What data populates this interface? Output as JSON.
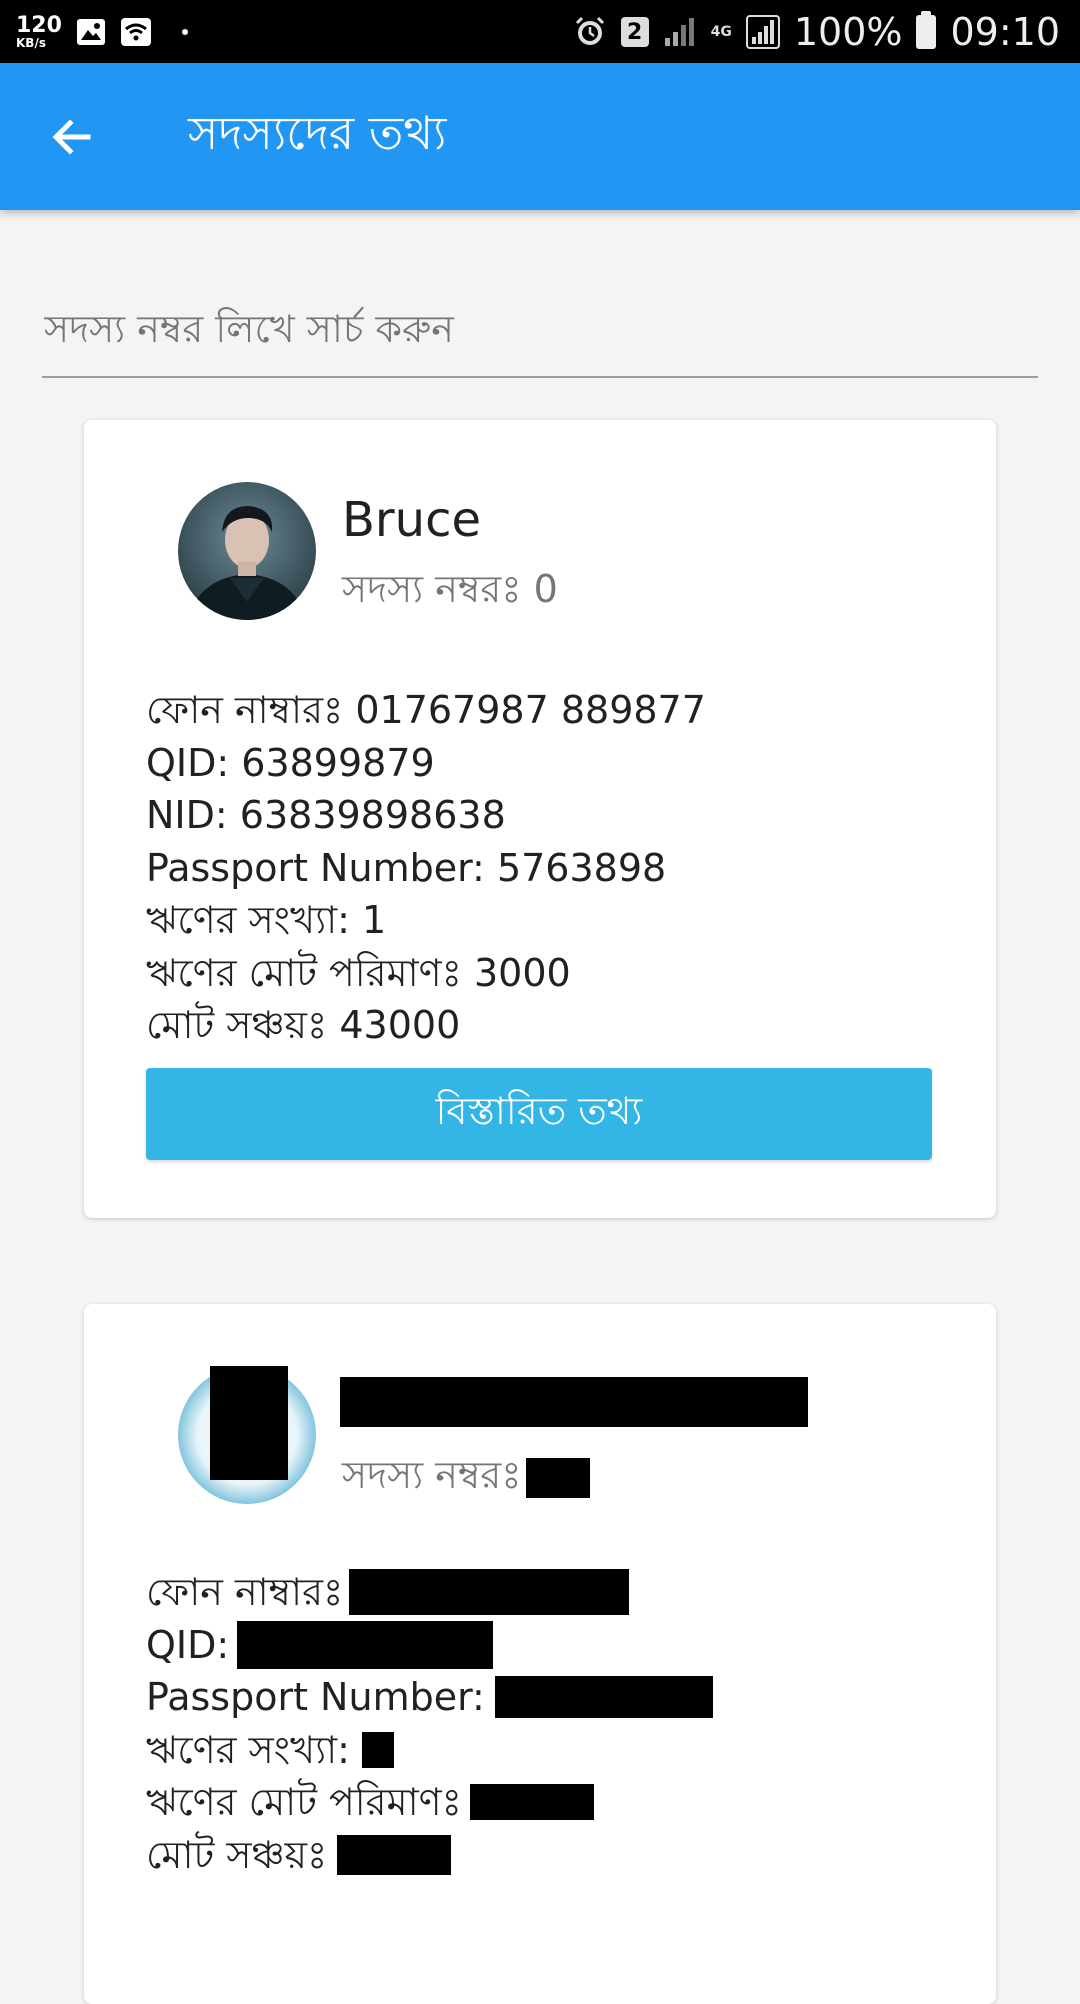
{
  "status_bar": {
    "speed_value": "120",
    "speed_unit": "KB/s",
    "sim_number": "2",
    "network_type": "4G",
    "battery_percent": "100%",
    "time": "09:10"
  },
  "app_bar": {
    "title": "সদস্যদের তথ্য"
  },
  "search": {
    "placeholder": "সদস্য নম্বর লিখে সার্চ করুন"
  },
  "members": [
    {
      "name": "Bruce",
      "member_no_label": "সদস্য নম্বরঃ",
      "member_no": "0",
      "phone_label": "ফোন নাম্বারঃ",
      "phone": "01767987 889877",
      "qid_label": "QID:",
      "qid": "63899879",
      "nid_label": "NID:",
      "nid": "63839898638",
      "passport_label": "Passport Number:",
      "passport": "5763898",
      "loan_count_label": "ঋণের সংখ্যা:",
      "loan_count": "1",
      "loan_total_label": "ঋণের মোট পরিমাণঃ",
      "loan_total": "3000",
      "savings_label": "মোট সঞ্চয়ঃ",
      "savings": "43000",
      "details_button": "বিস্তারিত তথ্য"
    },
    {
      "member_no_label": "সদস্য নম্বরঃ",
      "phone_label": "ফোন নাম্বারঃ",
      "qid_label": "QID:",
      "passport_label": "Passport Number:",
      "loan_count_label": "ঋণের সংখ্যা:",
      "loan_total_label": "ঋণের মোট পরিমাণঃ",
      "savings_label": "মোট সঞ্চয়ঃ"
    }
  ],
  "colors": {
    "app_bar": "#2196f3",
    "button": "#33b5e5",
    "background": "#f4f4f4"
  }
}
